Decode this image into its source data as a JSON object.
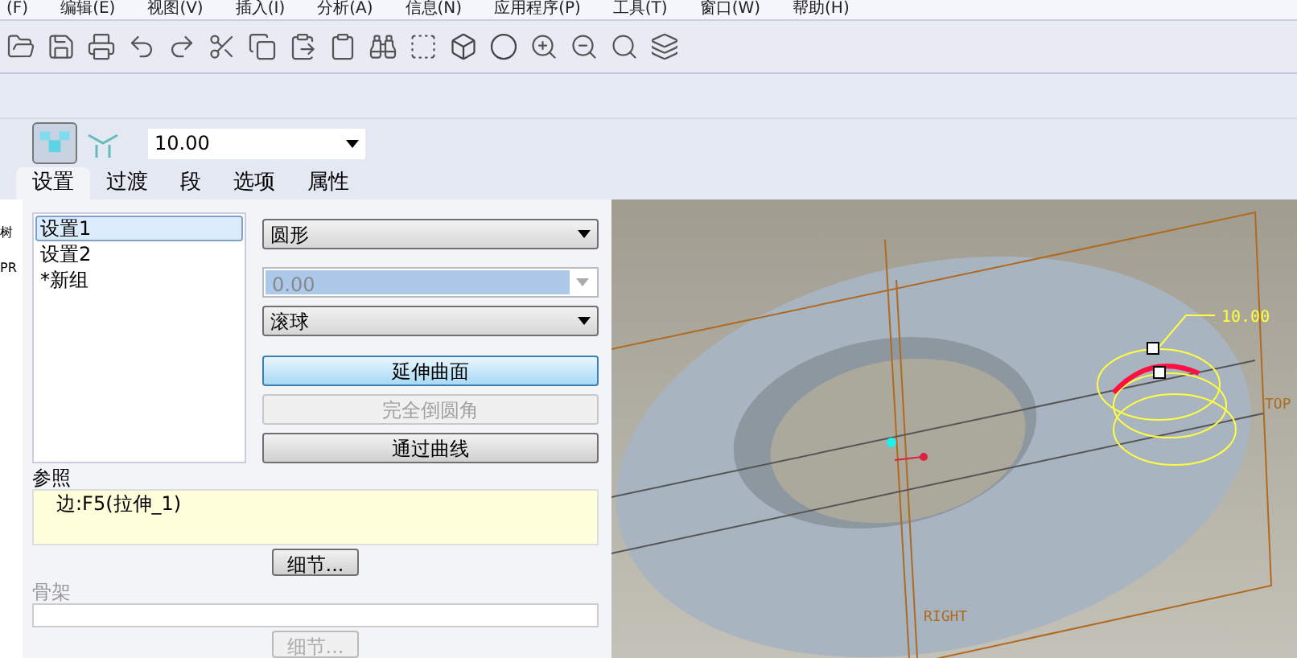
{
  "menu_bar": [
    "(F)",
    "编辑(E)",
    "视图(V)",
    "插入(I)",
    "分析(A)",
    "信息(N)",
    "应用程序(P)",
    "工具(T)",
    "窗口(W)",
    "帮助(H)"
  ],
  "left_strip": [
    "树",
    "PR"
  ],
  "dashboard": {
    "value": "10.00"
  },
  "tabs": [
    {
      "label": "设置",
      "selected": true
    },
    {
      "label": "过渡",
      "selected": false
    },
    {
      "label": "段",
      "selected": false
    },
    {
      "label": "选项",
      "selected": false
    },
    {
      "label": "属性",
      "selected": false
    }
  ],
  "sets": [
    {
      "label": "设置1",
      "selected": true
    },
    {
      "label": "设置2",
      "selected": false
    },
    {
      "label": "*新组",
      "selected": false
    }
  ],
  "shape_dropdown": "圆形",
  "radius_field": {
    "value": "0.00",
    "disabled": true
  },
  "method_dropdown": "滚球",
  "buttons": [
    {
      "label": "延伸曲面",
      "selected": true,
      "disabled": false
    },
    {
      "label": "完全倒圆角",
      "selected": false,
      "disabled": true
    },
    {
      "label": "通过曲线",
      "selected": false,
      "disabled": false
    }
  ],
  "references": {
    "label": "参照",
    "items": [
      "边:F5(拉伸_1)"
    ],
    "details": "细节..."
  },
  "skeleton": {
    "label": "骨架",
    "details": "细节..."
  },
  "viewport": {
    "dimension": "10.00",
    "planes": [
      "TOP",
      "RIGHT"
    ]
  }
}
